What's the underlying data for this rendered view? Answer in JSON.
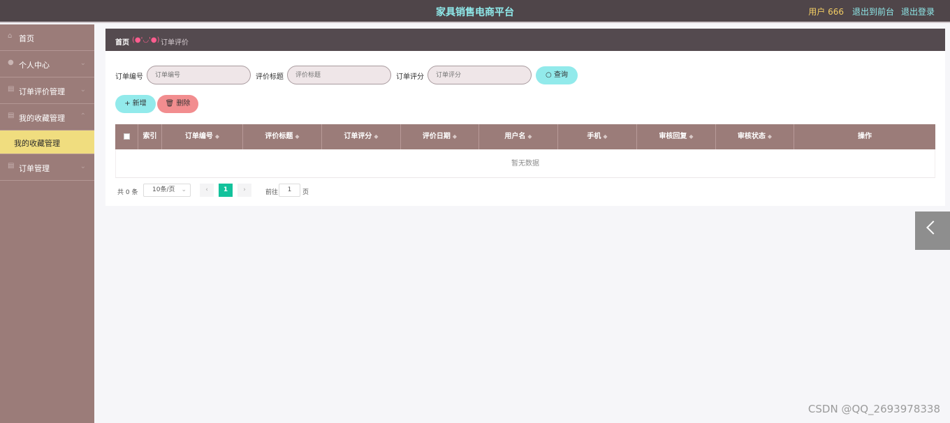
{
  "header": {
    "title": "家具销售电商平台",
    "user_label": "用户 666",
    "back_to_front": "退出到前台",
    "logout": "退出登录"
  },
  "sidebar": {
    "items": [
      {
        "label": "首页",
        "icon": "home-icon"
      },
      {
        "label": "个人中心",
        "icon": "user-icon"
      },
      {
        "label": "订单评价管理",
        "icon": "list-icon"
      },
      {
        "label": "我的收藏管理",
        "icon": "list-icon"
      },
      {
        "label": "我的收藏管理",
        "icon": "",
        "active": true
      },
      {
        "label": "订单管理",
        "icon": "list-icon"
      }
    ]
  },
  "breadcrumb": {
    "home": "首页",
    "face": "(●'◡'●)",
    "current": "订单评价"
  },
  "search": {
    "order_no_label": "订单编号",
    "order_no_placeholder": "订单编号",
    "title_label": "评价标题",
    "title_placeholder": "评价标题",
    "score_label": "订单评分",
    "score_placeholder": "订单评分",
    "query_button": "查询"
  },
  "actions": {
    "add_button": "新增",
    "delete_button": "删除"
  },
  "table": {
    "columns": [
      "索引",
      "订单编号",
      "评价标题",
      "订单评分",
      "评价日期",
      "用户名",
      "手机",
      "审核回复",
      "审核状态",
      "操作"
    ],
    "empty_text": "暂无数据"
  },
  "pagination": {
    "total_text": "共 0 条",
    "page_size": "10条/页",
    "current_page": "1",
    "goto_label": "前往",
    "goto_value": "1",
    "goto_unit": "页"
  },
  "watermark": "CSDN @QQ_2693978338",
  "colors": {
    "topbar": "#4f4549",
    "sidebar": "#9b7c79",
    "accent_cyan": "#92eaeb",
    "accent_red": "#f28d8f",
    "active_menu": "#f0dd7f",
    "active_page": "#13c29c"
  }
}
